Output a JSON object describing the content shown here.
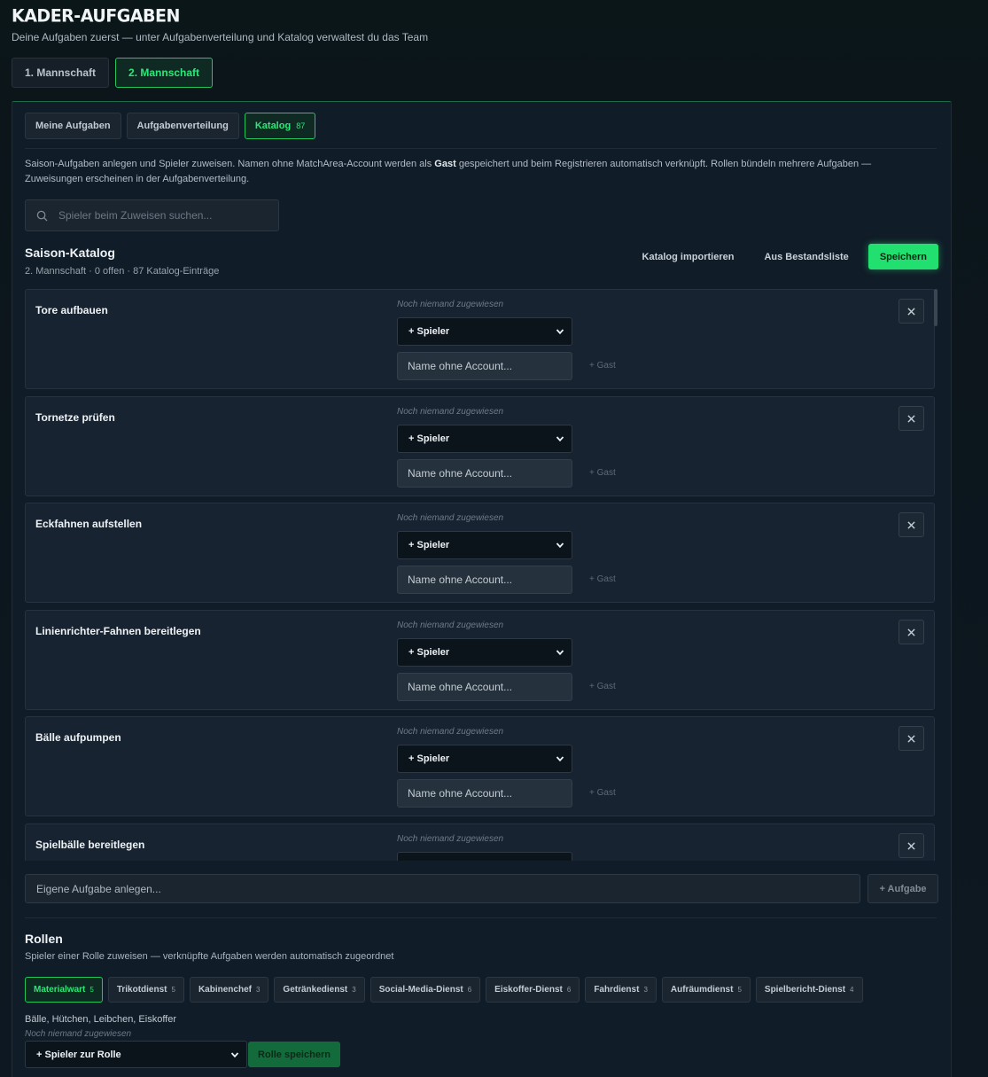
{
  "header": {
    "title": "KADER-AUFGABEN",
    "subtitle": "Deine Aufgaben zuerst — unter Aufgabenverteilung und Katalog verwaltest du das Team"
  },
  "team_tabs": [
    {
      "label": "1. Mannschaft",
      "active": false
    },
    {
      "label": "2. Mannschaft",
      "active": true
    }
  ],
  "sub_tabs": [
    {
      "label": "Meine Aufgaben",
      "count": "",
      "active": false
    },
    {
      "label": "Aufgabenverteilung",
      "count": "",
      "active": false
    },
    {
      "label": "Katalog",
      "count": "87",
      "active": true
    }
  ],
  "intro": {
    "part1": "Saison-Aufgaben anlegen und Spieler zuweisen. Namen ohne MatchArea-Account werden als ",
    "bold": "Gast",
    "part2": " gespeichert und beim Registrieren automatisch verknüpft. Rollen bündeln mehrere Aufgaben — Zuweisungen erscheinen in der Aufgabenverteilung."
  },
  "search": {
    "placeholder": "Spieler beim Zuweisen suchen..."
  },
  "catalog": {
    "title": "Saison-Katalog",
    "meta": "2. Mannschaft · 0 offen · 87 Katalog-Einträge",
    "import_label": "Katalog importieren",
    "from_list_label": "Aus Bestandsliste",
    "save_label": "Speichern"
  },
  "task_labels": {
    "assign_status": "Noch niemand zugewiesen",
    "select_label": "+ Spieler",
    "guest_placeholder": "Name ohne Account...",
    "guest_button": "+ Gast"
  },
  "tasks": [
    {
      "name": "Tore aufbauen"
    },
    {
      "name": "Tornetze prüfen"
    },
    {
      "name": "Eckfahnen aufstellen"
    },
    {
      "name": "Linienrichter-Fahnen bereitlegen"
    },
    {
      "name": "Bälle aufpumpen"
    },
    {
      "name": "Spielbälle bereitlegen"
    }
  ],
  "new_task": {
    "placeholder": "Eigene Aufgabe anlegen...",
    "button_label": "+ Aufgabe"
  },
  "roles": {
    "title": "Rollen",
    "subtitle": "Spieler einer Rolle zuweisen — verknüpfte Aufgaben werden automatisch zugeordnet",
    "chips": [
      {
        "label": "Materialwart",
        "count": "5",
        "active": true
      },
      {
        "label": "Trikotdienst",
        "count": "5",
        "active": false
      },
      {
        "label": "Kabinenchef",
        "count": "3",
        "active": false
      },
      {
        "label": "Getränkedienst",
        "count": "3",
        "active": false
      },
      {
        "label": "Social-Media-Dienst",
        "count": "6",
        "active": false
      },
      {
        "label": "Eiskoffer-Dienst",
        "count": "6",
        "active": false
      },
      {
        "label": "Fahrdienst",
        "count": "3",
        "active": false
      },
      {
        "label": "Aufräumdienst",
        "count": "5",
        "active": false
      },
      {
        "label": "Spielbericht-Dienst",
        "count": "4",
        "active": false
      }
    ],
    "selected_tasks": "Bälle, Hütchen, Leibchen, Eiskoffer",
    "assign_status": "Noch niemand zugewiesen",
    "select_label": "+ Spieler zur Rolle",
    "save_label": "Rolle speichern"
  },
  "colors": {
    "accent": "#22e06f",
    "background": "#0d1822",
    "card": "#172330"
  }
}
